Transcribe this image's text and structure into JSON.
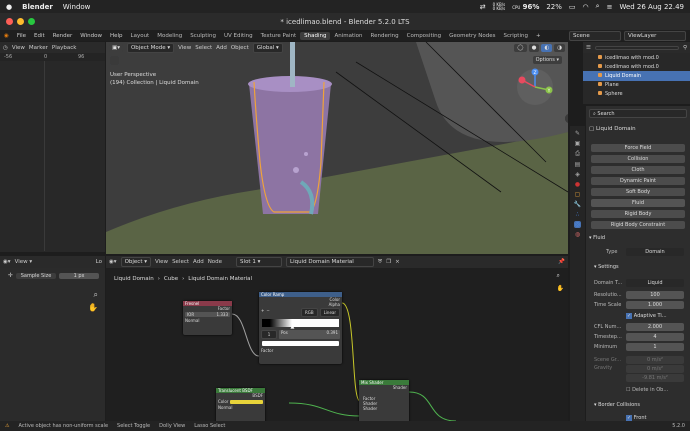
{
  "system": {
    "app": "Blender",
    "menu": "Window",
    "kb1": "0 KB/s",
    "kb2": "0 KB/s",
    "cpu": "96%",
    "cpu_label": "CPU",
    "battery": "22%",
    "datetime": "Wed 26 Aug 22.49"
  },
  "window": {
    "title": "* icedlimao.blend - Blender 5.2.0 LTS"
  },
  "menus": [
    "File",
    "Edit",
    "Render",
    "Window",
    "Help"
  ],
  "workspaces": [
    "Layout",
    "Modeling",
    "Sculpting",
    "UV Editing",
    "Texture Paint",
    "Shading",
    "Animation",
    "Rendering",
    "Compositing",
    "Geometry Nodes",
    "Scripting"
  ],
  "active_workspace": "Shading",
  "scene": {
    "scene": "Scene",
    "view_layer": "ViewLayer"
  },
  "timeline": {
    "view": "View",
    "marker": "Marker",
    "playback": "Playback",
    "ticks": [
      "-56",
      "0",
      "96"
    ]
  },
  "viewport": {
    "mode": "Object Mode",
    "menus": [
      "View",
      "Select",
      "Add",
      "Object"
    ],
    "orientation": "Global",
    "perspective": "User Perspective",
    "collection": "(194) Collection | Liquid Domain",
    "options": "Options",
    "axis_y": "Y",
    "axis_z": "Z"
  },
  "outliner": {
    "search": "",
    "items": [
      {
        "name": "icedlimao with mod.0"
      },
      {
        "name": "icedlimao with mod.0"
      },
      {
        "name": "Liquid Domain"
      },
      {
        "name": "Plane"
      },
      {
        "name": "Sphere"
      }
    ]
  },
  "properties": {
    "search": "Search",
    "object": "Liquid Domain",
    "physics": [
      "Force Field",
      "Collision",
      "Cloth",
      "Dynamic Paint",
      "Soft Body",
      "Fluid",
      "Rigid Body",
      "Rigid Body Constraint"
    ],
    "fluid": {
      "header": "Fluid",
      "type_label": "Type",
      "type_value": "Domain",
      "settings": "Settings",
      "domain_type_label": "Domain T...",
      "domain_type": "Liquid",
      "resolution_label": "Resolutio...",
      "resolution": "100",
      "time_scale_label": "Time Scale",
      "time_scale": "1.000",
      "adaptive": "Adaptive Ti...",
      "cfl_label": "CFL Num...",
      "cfl": "2.000",
      "timestep_label": "Timestep...",
      "timestep": "4",
      "minimum_label": "Minimum",
      "minimum": "1",
      "gravity_label": "Gravity",
      "gx": "0 m/s²",
      "gy": "0 m/s²",
      "gz": "-9.81 m/s²",
      "scene_gravity": "Scene Gr...",
      "delete_label": "Delete in Ob...",
      "border": "Border Collisions",
      "front": "Front"
    }
  },
  "imageeditor": {
    "view": "View",
    "sample_label": "Sample Size",
    "sample_value": "1 px",
    "cut": "Lo"
  },
  "nodeeditor": {
    "object": "Object",
    "menus": [
      "View",
      "Select",
      "Add",
      "Node"
    ],
    "slot": "Slot 1",
    "material": "Liquid Domain Material",
    "breadcrumb": [
      "Liquid Domain",
      "Cube",
      "Liquid Domain Material"
    ],
    "fresnel": {
      "title": "Fresnel",
      "factor": "Factor",
      "ior_label": "IOR",
      "ior": "1.333",
      "normal": "Normal"
    },
    "colorramp": {
      "title": "Color Ramp",
      "color": "Color",
      "alpha": "Alpha",
      "mode": "RGB",
      "interp": "Linear",
      "index": "1",
      "pos_label": "Pos",
      "pos": "0.391",
      "factor": "Factor"
    },
    "mix": {
      "title": "Mix Shader",
      "shader": "Shader",
      "factor": "Factor",
      "in1": "Shader",
      "in2": "Shader"
    },
    "translucent": {
      "title": "Translucent BSDF",
      "bsdf": "BSDF",
      "color": "Color",
      "normal": "Normal"
    }
  },
  "status": {
    "left": "Active object has non-uniform scale",
    "select": "Select Toggle",
    "dolly": "Dolly View",
    "lasso": "Lasso Select",
    "version": "5.2.0"
  },
  "colors": {
    "accent": "#4772b3",
    "selection": "#e89f3c",
    "header": "#2a2a2a"
  }
}
